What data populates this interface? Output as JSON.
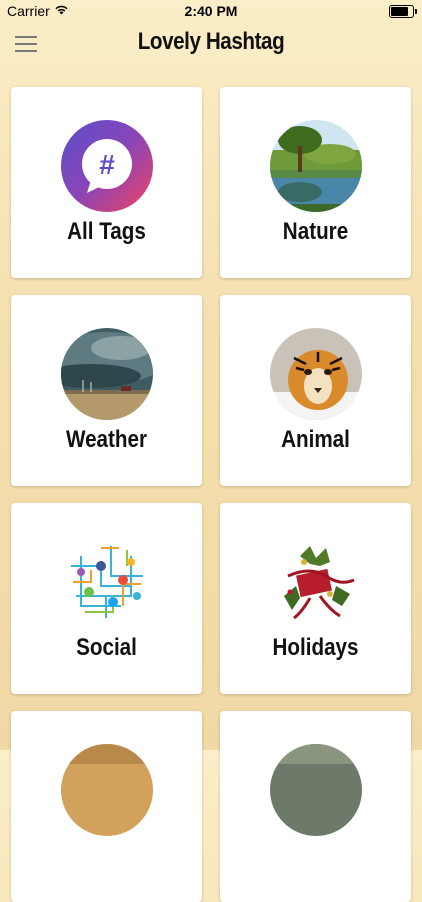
{
  "status_bar": {
    "carrier": "Carrier",
    "time": "2:40 PM",
    "battery_level": 0.9
  },
  "nav": {
    "title": "Lovely Hashtag",
    "menu_icon": "hamburger-icon"
  },
  "categories": [
    {
      "label": "All Tags",
      "image": "hashtag-bubble-icon"
    },
    {
      "label": "Nature",
      "image": "nature-lake-photo"
    },
    {
      "label": "Weather",
      "image": "storm-cloud-photo"
    },
    {
      "label": "Animal",
      "image": "tiger-photo"
    },
    {
      "label": "Social",
      "image": "social-network-globe-image"
    },
    {
      "label": "Holidays",
      "image": "holiday-wreath-image"
    },
    {
      "label": "",
      "image": "partial-photo"
    },
    {
      "label": "",
      "image": "partial-photo"
    }
  ],
  "colors": {
    "background_top": "#fbeec8",
    "background_bottom": "#f1d9a6",
    "hashtag_gradient_start": "#6a4bc4",
    "hashtag_gradient_end": "#f0435f"
  }
}
